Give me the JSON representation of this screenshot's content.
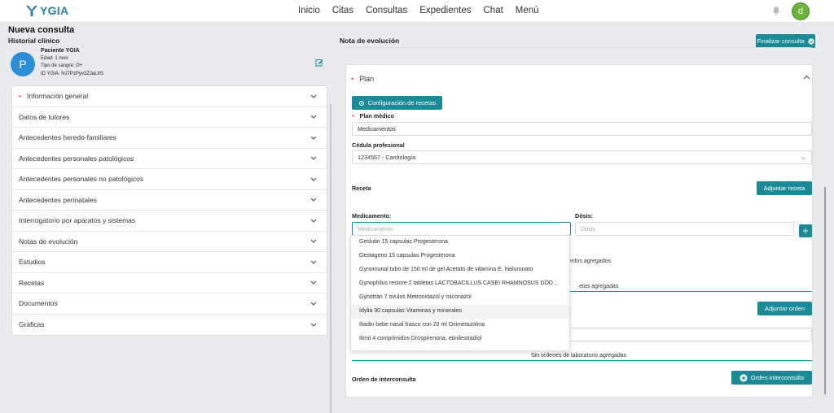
{
  "app": {
    "name": "YGIA",
    "user_initial": "d"
  },
  "nav": [
    "Inicio",
    "Citas",
    "Consultas",
    "Expedientes",
    "Chat",
    "Menú"
  ],
  "left": {
    "title": "Nueva consulta",
    "section": "Historial clínico",
    "patient": {
      "initial": "P",
      "name": "Paciente YGIA",
      "age": "Edad: 1 mes",
      "blood": "Tipo de sangre: O+",
      "id": "ID YGIA: NJ7PzPyv2ZJaLIIS"
    },
    "accordion": [
      {
        "label": "Información general",
        "required": true
      },
      {
        "label": "Datos de tutores",
        "required": false
      },
      {
        "label": "Antecedentes heredo-familiares",
        "required": false
      },
      {
        "label": "Antecedentes personales patológicos",
        "required": false
      },
      {
        "label": "Antecedentes personales no patológicos",
        "required": false
      },
      {
        "label": "Antecedentes perinatales",
        "required": false
      },
      {
        "label": "Interrogatorio por aparatos y sistemas",
        "required": false
      },
      {
        "label": "Notas de evolución",
        "required": false
      },
      {
        "label": "Estudios",
        "required": false
      },
      {
        "label": "Recetas",
        "required": false
      },
      {
        "label": "Documentos",
        "required": false
      },
      {
        "label": "Gráficas",
        "required": false
      }
    ]
  },
  "right": {
    "title": "Nota de evolución",
    "finalize_label": "Finalizar consulta",
    "plan_header": "Plan",
    "config_recetas": "Configuración de recetas",
    "plan_medico_label": "Plan médico",
    "plan_medico_value": "Medicamentos",
    "cedula_label": "Cédula profesional",
    "cedula_value": "1234567 - Cardiología",
    "receta_label": "Receta",
    "adjuntar_receta": "Adjuntar receta",
    "medicamento_label": "Medicamento:",
    "medicamento_placeholder": "Medicamento",
    "dosis_label": "Dósis:",
    "dosis_placeholder": "Dósis",
    "medicamentos_agregados": "mentos agregados",
    "recetas_agregadas": "etas agregadas",
    "adjuntar_orden": "Adjuntar orden",
    "sin_ordenes": "Sin ordenes de laboratorio agregadas",
    "orden_interconsulta_label": "Orden de interconsulta",
    "orden_interconsulta_btn": "Orden interconsulta"
  },
  "dropdown": [
    "Geslutin 15 capsulas Progesterona",
    "Gestageno 15 capsulas Progesterona",
    "Gynomunal tubo de 150 ml de gel Acetato de vitamina E. hialuronato",
    "Gynophilus restore 2 tabletas LACTOBACILLUS CASEI RHAMNOSUS DÖDE...",
    "Gynotran 7 ovulos Metronidazol y miconazol",
    "Idylia 30 capsulas Vitaminas y minerales",
    "Iliadin bebe nasal frasco con 20 ml Oximetazolina",
    "Ilimit 4 comprimidos Drospirenona, etinilestradiol"
  ],
  "colors": {
    "accent": "#1a8a96",
    "avatar": "#2d8ed8",
    "user": "#6cb33f",
    "required": "#e0443c"
  }
}
